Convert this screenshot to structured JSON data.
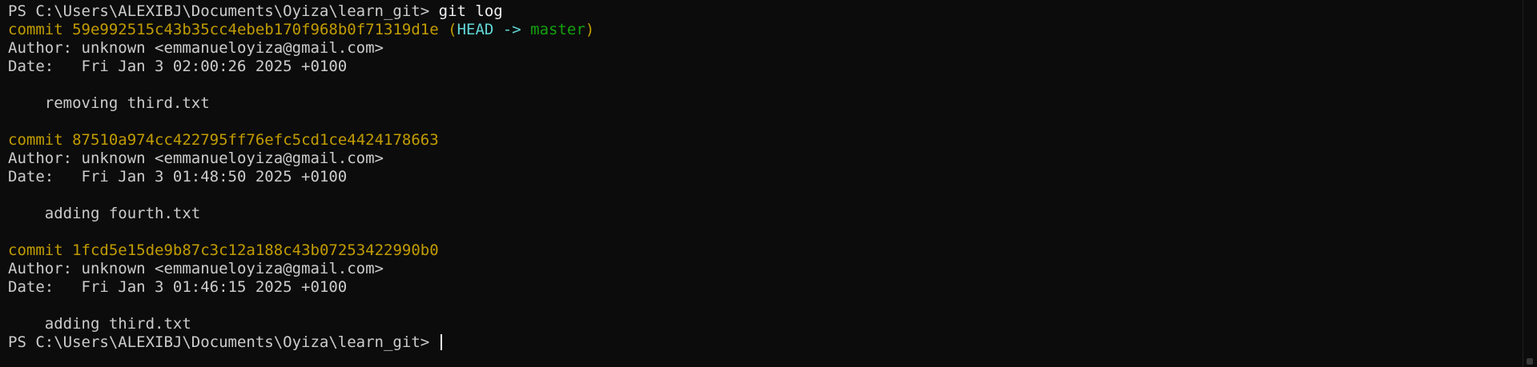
{
  "terminal": {
    "prompt_path": "PS C:\\Users\\ALEXIBJ\\Documents\\Oyiza\\learn_git>",
    "command": "git log",
    "colors": {
      "background": "#0c0c0c",
      "text": "#cccccc",
      "commit": "#c19c00",
      "head": "#61d6d6",
      "branch": "#13a10e"
    },
    "commits": [
      {
        "label": "commit",
        "hash": "59e992515c43b35cc4ebeb170f968b0f71319d1e",
        "ref_open": "(",
        "head": "HEAD",
        "arrow": "->",
        "branch": "master",
        "ref_close": ")",
        "author_line": "Author: unknown <emmanueloyiza@gmail.com>",
        "date_line": "Date:   Fri Jan 3 02:00:26 2025 +0100",
        "message": "    removing third.txt"
      },
      {
        "label": "commit",
        "hash": "87510a974cc422795ff76efc5cd1ce4424178663",
        "author_line": "Author: unknown <emmanueloyiza@gmail.com>",
        "date_line": "Date:   Fri Jan 3 01:48:50 2025 +0100",
        "message": "    adding fourth.txt"
      },
      {
        "label": "commit",
        "hash": "1fcd5e15de9b87c3c12a188c43b07253422990b0",
        "author_line": "Author: unknown <emmanueloyiza@gmail.com>",
        "date_line": "Date:   Fri Jan 3 01:46:15 2025 +0100",
        "message": "    adding third.txt"
      }
    ]
  }
}
